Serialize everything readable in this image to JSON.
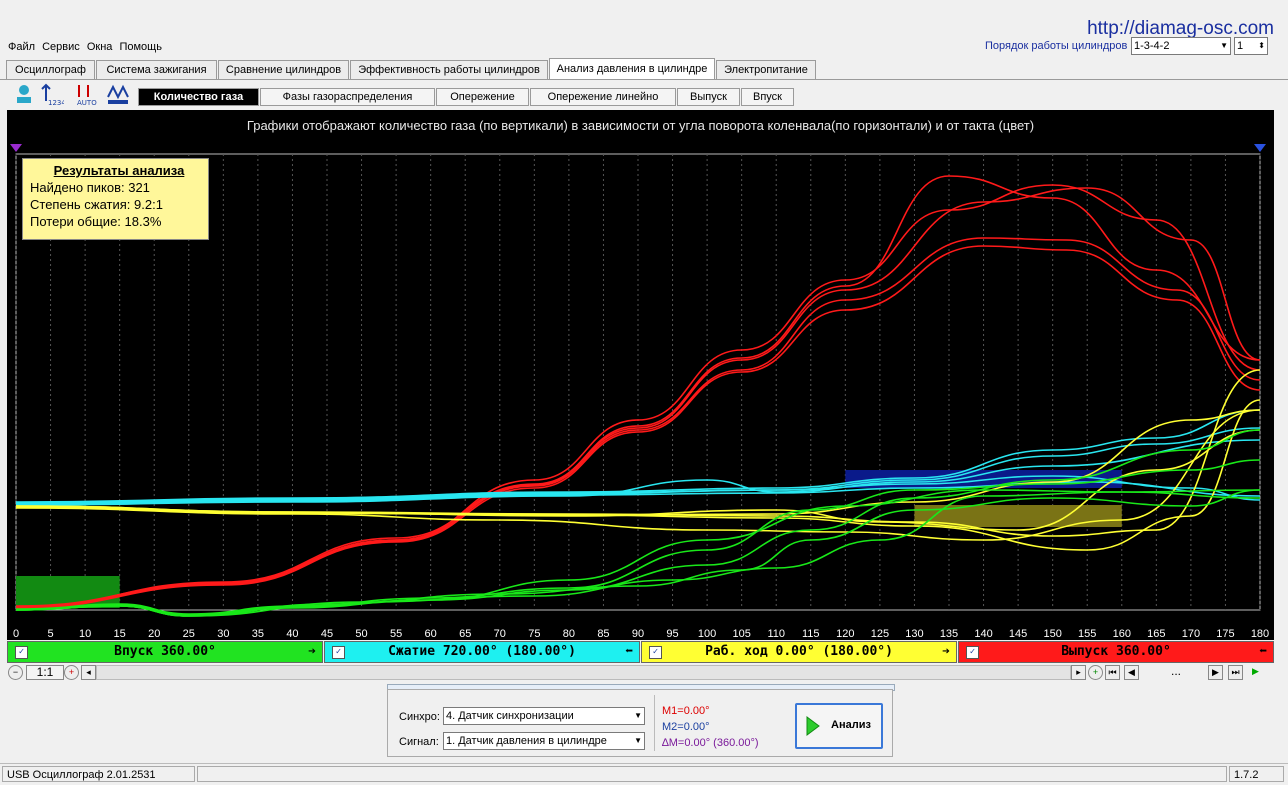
{
  "url": "http://diamag-osc.com",
  "menu": [
    "Файл",
    "Сервис",
    "Окна",
    "Помощь"
  ],
  "order": {
    "label": "Порядок работы цилиндров",
    "value": "1-3-4-2",
    "cyl": "1"
  },
  "tabs": [
    "Осциллограф",
    "Система зажигания",
    "Сравнение цилиндров",
    "Эффективность работы цилиндров",
    "Анализ давления в цилиндре",
    "Электропитание"
  ],
  "active_tab": 4,
  "subtabs": [
    "Количество газа",
    "Фазы газораспределения",
    "Опережение",
    "Опережение линейно",
    "Выпуск",
    "Впуск"
  ],
  "active_subtab": 0,
  "toolbar_icons": [
    "tree-icon",
    "scale-icon",
    "auto-icon",
    "peaks-icon"
  ],
  "chart": {
    "title": "Графики отображают количество газа (по вертикали) в зависимости от угла поворота коленвала(по горизонтали) и от такта (цвет)",
    "results": {
      "title": "Результаты анализа",
      "peaks": "Найдено пиков: 321",
      "compression": "Степень сжатия: 9.2:1",
      "losses": "Потери общие: 18.3%"
    }
  },
  "chart_data": {
    "type": "line",
    "x": {
      "min": 0,
      "max": 180,
      "ticks": [
        0,
        5,
        10,
        15,
        20,
        25,
        30,
        35,
        40,
        45,
        50,
        55,
        60,
        65,
        70,
        75,
        80,
        85,
        90,
        95,
        100,
        105,
        110,
        115,
        120,
        125,
        130,
        135,
        140,
        145,
        150,
        155,
        160,
        165,
        170,
        175,
        180
      ]
    },
    "series_colors": {
      "intake": "#19e819",
      "compression": "#29e6f0",
      "power": "#ffff33",
      "exhaust": "#ff1a1a"
    }
  },
  "strokes": [
    {
      "label": "Впуск 360.00°",
      "color": "#21e321",
      "arrow": "➔"
    },
    {
      "label": "Сжатие 720.00° (180.00°)",
      "color": "#1ef0f0",
      "arrow": "⬅"
    },
    {
      "label": "Раб. ход 0.00° (180.00°)",
      "color": "#ffff33",
      "arrow": "➔"
    },
    {
      "label": "Выпуск 360.00°",
      "color": "#ff1a1a",
      "arrow": "⬅"
    }
  ],
  "zoom": "1:1",
  "nav_dots": "...",
  "panel": {
    "sync_label": "Синхро:",
    "sync_value": "4.  Датчик синхронизации",
    "signal_label": "Сигнал:",
    "signal_value": "1.  Датчик давления в цилиндре",
    "m1": "M1=0.00°",
    "m2": "M2=0.00°",
    "dm": "∆M=0.00° (360.00°)",
    "analyze": "Анализ"
  },
  "status": {
    "left": "USB Осциллограф  2.01.2531",
    "version": "1.7.2"
  }
}
